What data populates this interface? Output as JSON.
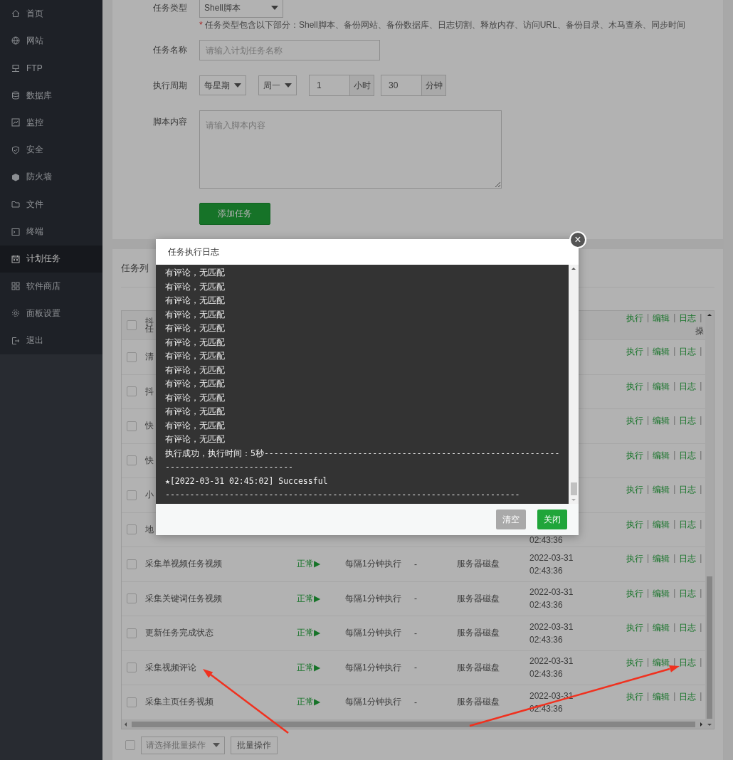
{
  "sidebar": {
    "items": [
      {
        "label": "首页",
        "selected": false
      },
      {
        "label": "网站",
        "selected": false
      },
      {
        "label": "FTP",
        "selected": false
      },
      {
        "label": "数据库",
        "selected": false
      },
      {
        "label": "监控",
        "selected": false
      },
      {
        "label": "安全",
        "selected": false
      },
      {
        "label": "防火墙",
        "selected": false
      },
      {
        "label": "文件",
        "selected": false
      },
      {
        "label": "终端",
        "selected": false
      },
      {
        "label": "计划任务",
        "selected": true
      },
      {
        "label": "软件商店",
        "selected": false
      },
      {
        "label": "面板设置",
        "selected": false
      },
      {
        "label": "退出",
        "selected": false
      }
    ]
  },
  "form": {
    "type_label": "任务类型",
    "type_value": "Shell脚本",
    "note_mark": "*",
    "note": "任务类型包含以下部分：Shell脚本、备份网站、备份数据库、日志切割、释放内存、访问URL、备份目录、木马查杀、同步时间",
    "name_label": "任务名称",
    "name_placeholder": "请输入计划任务名称",
    "period_label": "执行周期",
    "period_unit": "每星期",
    "weekday": "周一",
    "hour": "1",
    "hour_unit": "小时",
    "minute": "30",
    "minute_unit": "分钟",
    "script_label": "脚本内容",
    "script_placeholder": "请输入脚本内容",
    "submit": "添加任务"
  },
  "task_list": {
    "title": "任务列",
    "header": {
      "name_fragment": "任",
      "ops_fragment": "操"
    },
    "separator": "|",
    "rows": [
      {
        "kind": "covered",
        "checked": false,
        "name": "抖",
        "ops": [
          "执行",
          "编辑",
          "日志"
        ]
      },
      {
        "kind": "covered",
        "checked": false,
        "name": "清",
        "ops": [
          "执行",
          "编辑",
          "日志"
        ]
      },
      {
        "kind": "covered",
        "checked": false,
        "name": "抖",
        "ops": [
          "执行",
          "编辑",
          "日志"
        ]
      },
      {
        "kind": "covered",
        "checked": false,
        "name": "快",
        "ops": [
          "执行",
          "编辑",
          "日志"
        ]
      },
      {
        "kind": "covered",
        "checked": false,
        "name": "快",
        "ops": [
          "执行",
          "编辑",
          "日志"
        ]
      },
      {
        "kind": "covered",
        "checked": false,
        "name": "小",
        "ops": [
          "执行",
          "编辑",
          "日志"
        ]
      },
      {
        "kind": "covered",
        "checked": false,
        "name": "地",
        "time": [
          "02:43:36"
        ],
        "ops": [
          "执行",
          "编辑",
          "日志"
        ]
      },
      {
        "kind": "full",
        "checked": false,
        "name": "采集单视频任务视频",
        "status": "正常▶",
        "period": "每隔1分钟执行",
        "dash": "-",
        "backup": "服务器磁盘",
        "time": [
          "2022-03-31",
          "02:43:36"
        ],
        "ops": [
          "执行",
          "编辑",
          "日志"
        ]
      },
      {
        "kind": "full",
        "checked": false,
        "name": "采集关键词任务视频",
        "status": "正常▶",
        "period": "每隔1分钟执行",
        "dash": "-",
        "backup": "服务器磁盘",
        "time": [
          "2022-03-31",
          "02:43:36"
        ],
        "ops": [
          "执行",
          "编辑",
          "日志"
        ]
      },
      {
        "kind": "full",
        "checked": false,
        "name": "更新任务完成状态",
        "status": "正常▶",
        "period": "每隔1分钟执行",
        "dash": "-",
        "backup": "服务器磁盘",
        "time": [
          "2022-03-31",
          "02:43:36"
        ],
        "ops": [
          "执行",
          "编辑",
          "日志"
        ]
      },
      {
        "kind": "full",
        "checked": false,
        "name": "采集视频评论",
        "status": "正常▶",
        "period": "每隔1分钟执行",
        "dash": "-",
        "backup": "服务器磁盘",
        "time": [
          "2022-03-31",
          "02:43:36"
        ],
        "ops": [
          "执行",
          "编辑",
          "日志"
        ]
      },
      {
        "kind": "full",
        "checked": false,
        "name": "采集主页任务视频",
        "status": "正常▶",
        "period": "每隔1分钟执行",
        "dash": "-",
        "backup": "服务器磁盘",
        "time": [
          "2022-03-31",
          "02:43:36"
        ],
        "ops": [
          "执行",
          "编辑",
          "日志"
        ]
      }
    ],
    "batch_checked": false,
    "batch_placeholder": "请选择批量操作",
    "batch_button": "批量操作"
  },
  "dialog": {
    "title": "任务执行日志",
    "close": "×",
    "log": [
      "有评论，无匹配",
      "有评论，无匹配",
      "有评论，无匹配",
      "有评论，无匹配",
      "有评论，无匹配",
      "有评论，无匹配",
      "有评论，无匹配",
      "有评论，无匹配",
      "有评论，无匹配",
      "有评论，无匹配",
      "有评论，无匹配",
      "有评论，无匹配",
      "有评论，无匹配",
      "执行成功，执行时间：5秒--------------------------------------------------------------------------------------",
      "★[2022-03-31 02:45:02] Successful",
      "------------------------------------------------------------------------"
    ],
    "buttons": [
      {
        "label": "清空",
        "disabled": true
      },
      {
        "label": "关闭",
        "disabled": false
      }
    ]
  }
}
